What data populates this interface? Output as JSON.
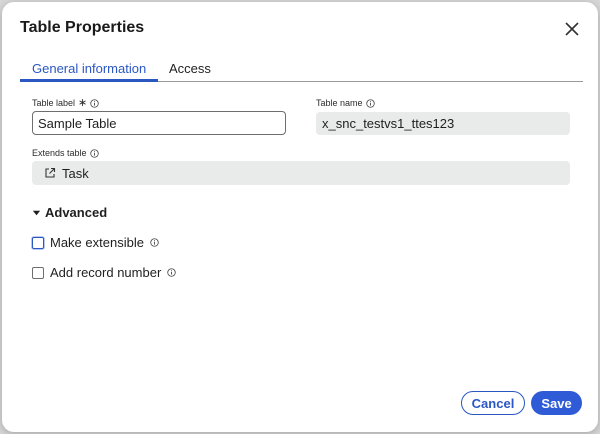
{
  "dialog": {
    "title": "Table Properties",
    "tabs": [
      {
        "label": "General information",
        "active": true
      },
      {
        "label": "Access",
        "active": false
      }
    ]
  },
  "fields": {
    "table_label": {
      "label": "Table label",
      "required": true,
      "value": "Sample Table"
    },
    "table_name": {
      "label": "Table name",
      "value": "x_snc_testvs1_ttes123"
    },
    "extends_table": {
      "label": "Extends table",
      "value": "Task"
    }
  },
  "advanced": {
    "label": "Advanced",
    "expanded": true,
    "options": [
      {
        "label": "Make extensible",
        "checked": false,
        "focused": true
      },
      {
        "label": "Add record number",
        "checked": false,
        "focused": false
      }
    ]
  },
  "actions": {
    "cancel_label": "Cancel",
    "save_label": "Save"
  },
  "colors": {
    "accent": "#2a57c2",
    "primary_button": "#2f5bd6",
    "readonly_bg": "#e9eaea"
  }
}
